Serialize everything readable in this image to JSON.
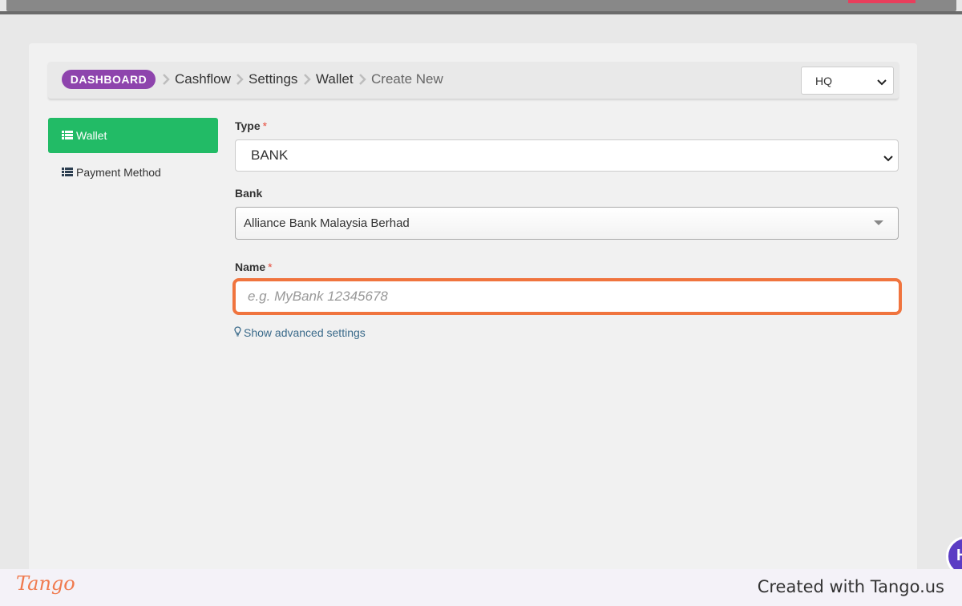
{
  "breadcrumb": {
    "root": "DASHBOARD",
    "items": [
      "Cashflow",
      "Settings",
      "Wallet"
    ],
    "current": "Create New"
  },
  "branch_select": {
    "value": "HQ"
  },
  "sidebar": {
    "items": [
      {
        "label": "Wallet",
        "icon": "list-icon",
        "active": true
      },
      {
        "label": "Payment Method",
        "icon": "list-icon",
        "active": false
      }
    ]
  },
  "form": {
    "type": {
      "label": "Type",
      "required_mark": "*",
      "value": "BANK"
    },
    "bank": {
      "label": "Bank",
      "value": "Alliance Bank Malaysia Berhad"
    },
    "name": {
      "label": "Name",
      "required_mark": "*",
      "value": "",
      "placeholder": "e.g. MyBank 12345678"
    },
    "advanced_link": "Show advanced settings"
  },
  "footer": {
    "logo": "Tango",
    "credit": "Created with Tango.us"
  },
  "colors": {
    "dashboard_pill": "#8e44ad",
    "active_sidebar": "#22bb66",
    "highlight": "#f0743e",
    "required": "#e74c3c"
  }
}
